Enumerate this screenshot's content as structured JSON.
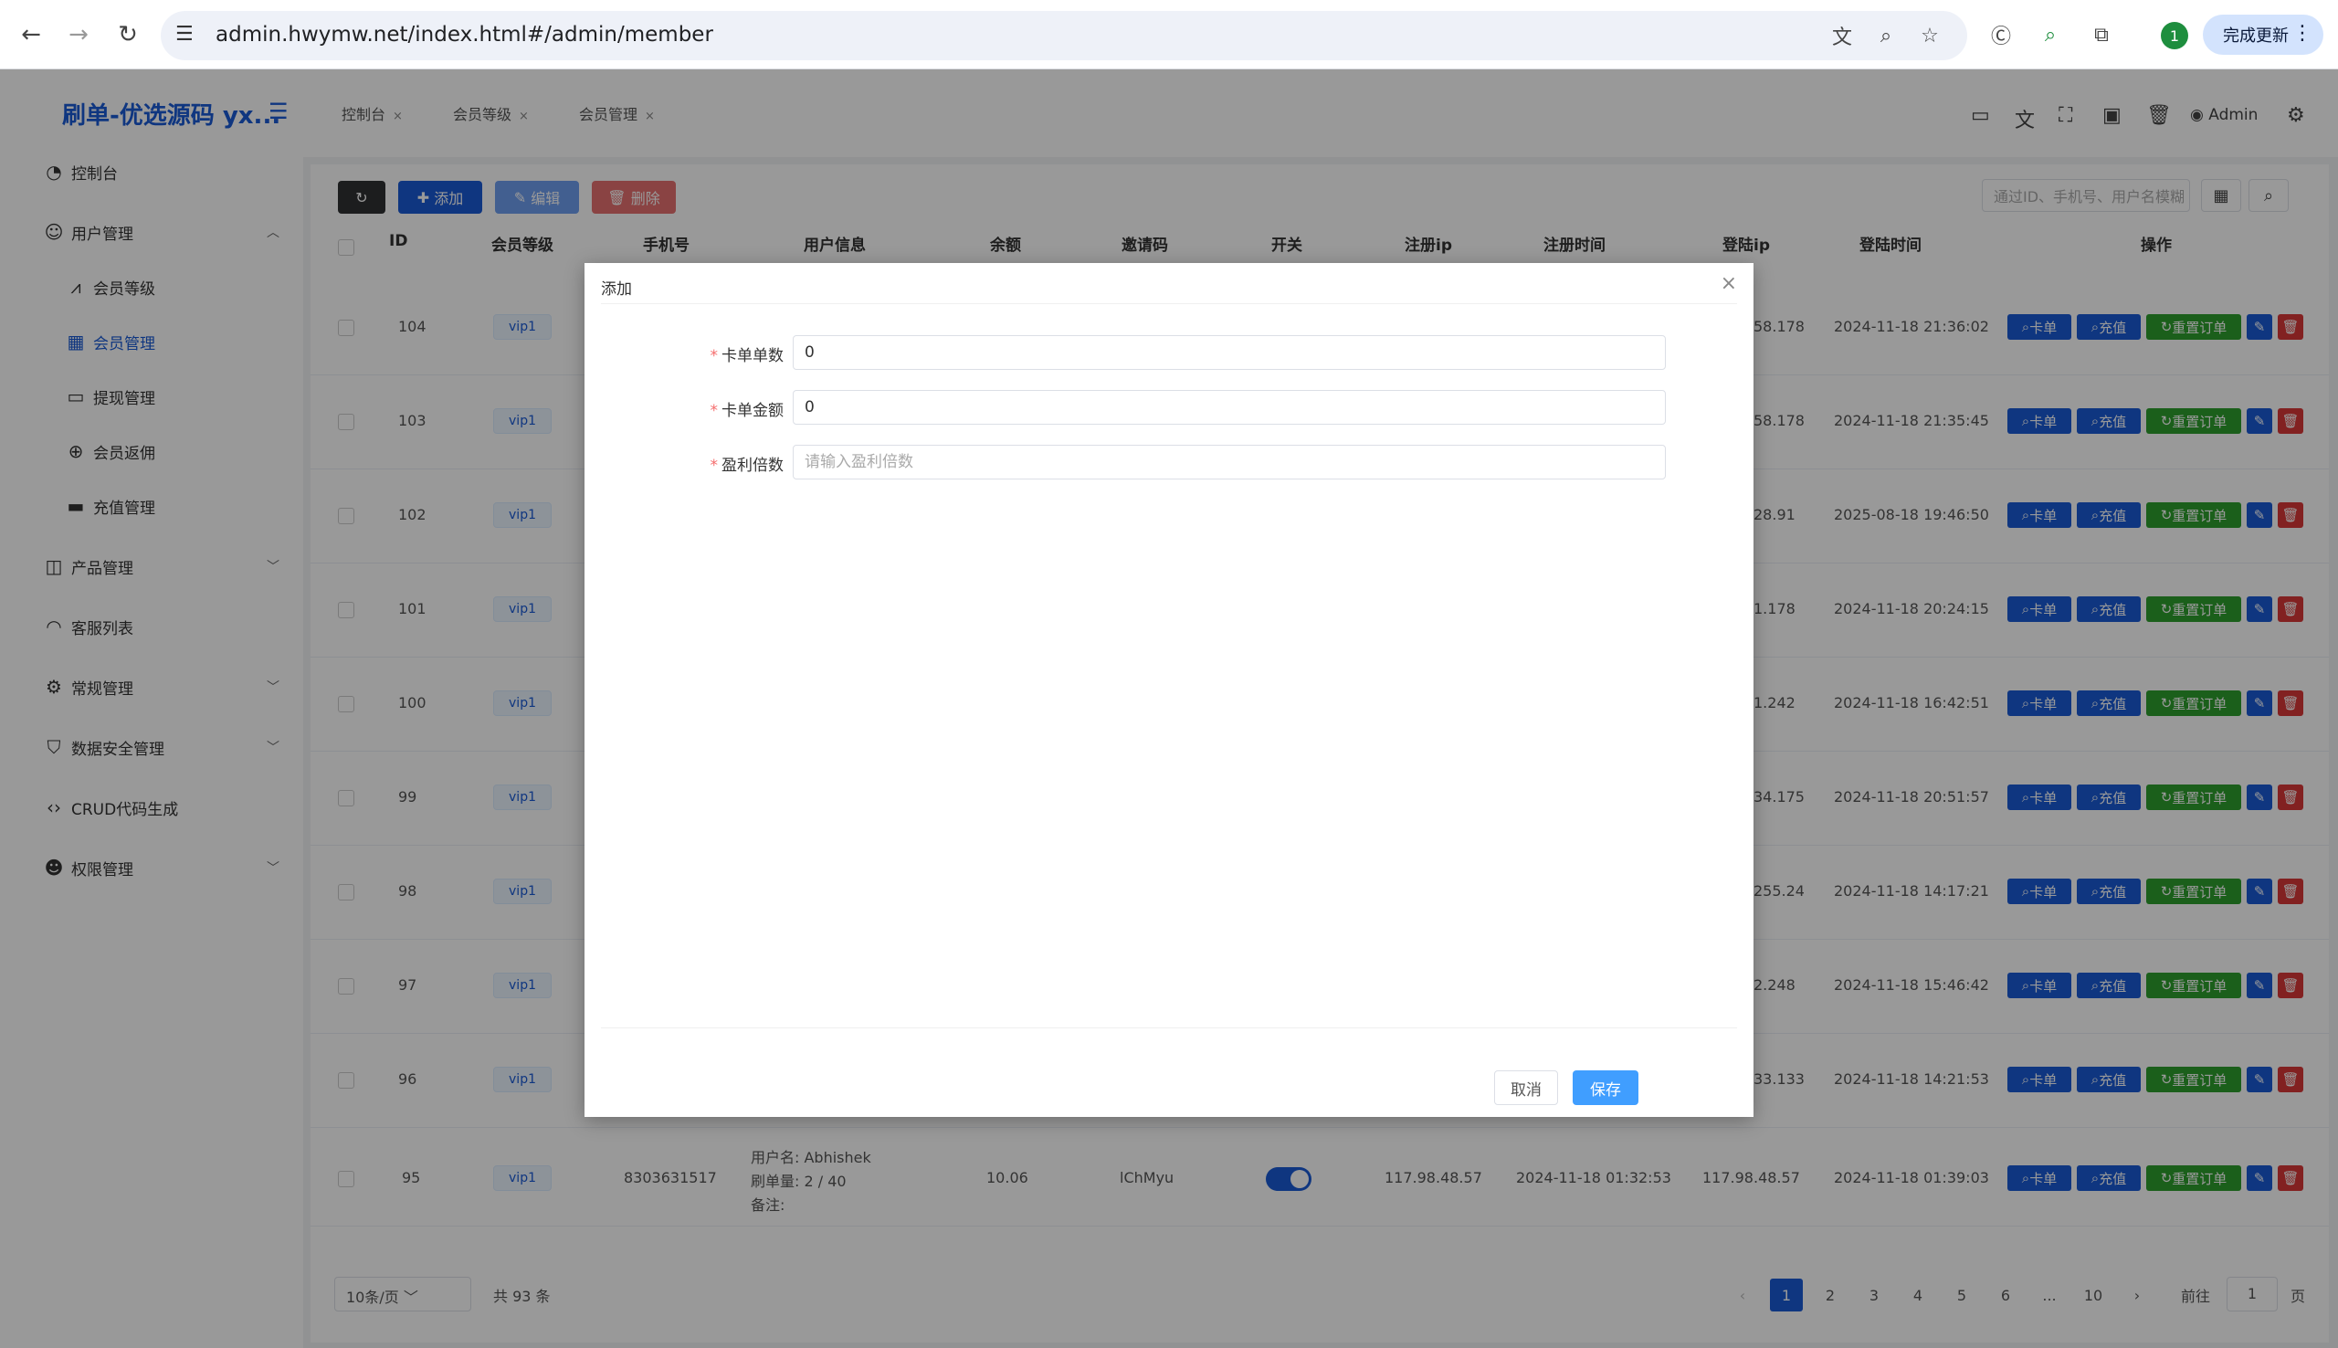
{
  "browser": {
    "url": "admin.hwymw.net/index.html#/admin/member",
    "update_label": "完成更新",
    "profile_initial": "1"
  },
  "sidebar": {
    "logo": "刷单-优选源码 yx...",
    "items": [
      {
        "label": "控制台",
        "icon": "dashboard-icon"
      },
      {
        "label": "用户管理",
        "icon": "user-icon"
      },
      {
        "label": "会员等级",
        "icon": "chart-icon"
      },
      {
        "label": "会员管理",
        "icon": "grid-icon"
      },
      {
        "label": "提现管理",
        "icon": "card-icon"
      },
      {
        "label": "会员返佣",
        "icon": "plus-circle-icon"
      },
      {
        "label": "充值管理",
        "icon": "briefcase-icon"
      },
      {
        "label": "产品管理",
        "icon": "bag-icon"
      },
      {
        "label": "客服列表",
        "icon": "headset-icon"
      },
      {
        "label": "常规管理",
        "icon": "gears-icon"
      },
      {
        "label": "数据安全管理",
        "icon": "shield-icon"
      },
      {
        "label": "CRUD代码生成",
        "icon": "code-icon"
      },
      {
        "label": "权限管理",
        "icon": "users-icon"
      }
    ]
  },
  "topbar": {
    "tabs": [
      "控制台",
      "会员等级",
      "会员管理"
    ],
    "admin": "Admin"
  },
  "toolbar": {
    "add": "添加",
    "edit": "编辑",
    "delete": "删除",
    "search_placeholder": "通过ID、手机号、用户名模糊"
  },
  "table": {
    "headers": [
      "ID",
      "会员等级",
      "手机号",
      "用户信息",
      "余额",
      "邀请码",
      "开关",
      "注册ip",
      "注册时间",
      "登陆ip",
      "登陆时间",
      "操作"
    ],
    "rows": [
      {
        "id": "104",
        "level": "vip1",
        "login_ip": "58.178",
        "login_time": "2024-11-18 21:36:02"
      },
      {
        "id": "103",
        "level": "vip1",
        "login_ip": "58.178",
        "login_time": "2024-11-18 21:35:45"
      },
      {
        "id": "102",
        "level": "vip1",
        "login_ip": "28.91",
        "login_time": "2025-08-18 19:46:50"
      },
      {
        "id": "101",
        "level": "vip1",
        "login_ip": "1.178",
        "login_time": "2024-11-18 20:24:15"
      },
      {
        "id": "100",
        "level": "vip1",
        "login_ip": "1.242",
        "login_time": "2024-11-18 16:42:51"
      },
      {
        "id": "99",
        "level": "vip1",
        "login_ip": "34.175",
        "login_time": "2024-11-18 20:51:57"
      },
      {
        "id": "98",
        "level": "vip1",
        "login_ip": "255.24",
        "login_time": "2024-11-18 14:17:21"
      },
      {
        "id": "97",
        "level": "vip1",
        "login_ip": "2.248",
        "login_time": "2024-11-18 15:46:42"
      },
      {
        "id": "96",
        "level": "vip1",
        "login_ip": "33.133",
        "login_time": "2024-11-18 14:21:53"
      }
    ],
    "last_row": {
      "id": "95",
      "level": "vip1",
      "phone": "8303631517",
      "username": "用户名: Abhishek",
      "orders": "刷单量: 2 / 40",
      "note": "备注:",
      "balance": "10.06",
      "invite": "lChMyu",
      "reg_ip": "117.98.48.57",
      "reg_time": "2024-11-18 01:32:53",
      "login_ip": "117.98.48.57",
      "login_time": "2024-11-18 01:39:03"
    },
    "actions": {
      "card": "卡单",
      "recharge": "充值",
      "reset": "重置订单"
    }
  },
  "pagination": {
    "page_size": "10条/页",
    "total": "共 93 条",
    "pages": [
      "1",
      "2",
      "3",
      "4",
      "5",
      "6",
      "...",
      "10"
    ],
    "goto": "前往",
    "goto_value": "1",
    "page_unit": "页"
  },
  "dialog": {
    "title": "添加",
    "fields": [
      {
        "label": "卡单单数",
        "value": "0",
        "placeholder": ""
      },
      {
        "label": "卡单金额",
        "value": "0",
        "placeholder": ""
      },
      {
        "label": "盈利倍数",
        "value": "",
        "placeholder": "请输入盈利倍数"
      }
    ],
    "cancel": "取消",
    "save": "保存"
  }
}
